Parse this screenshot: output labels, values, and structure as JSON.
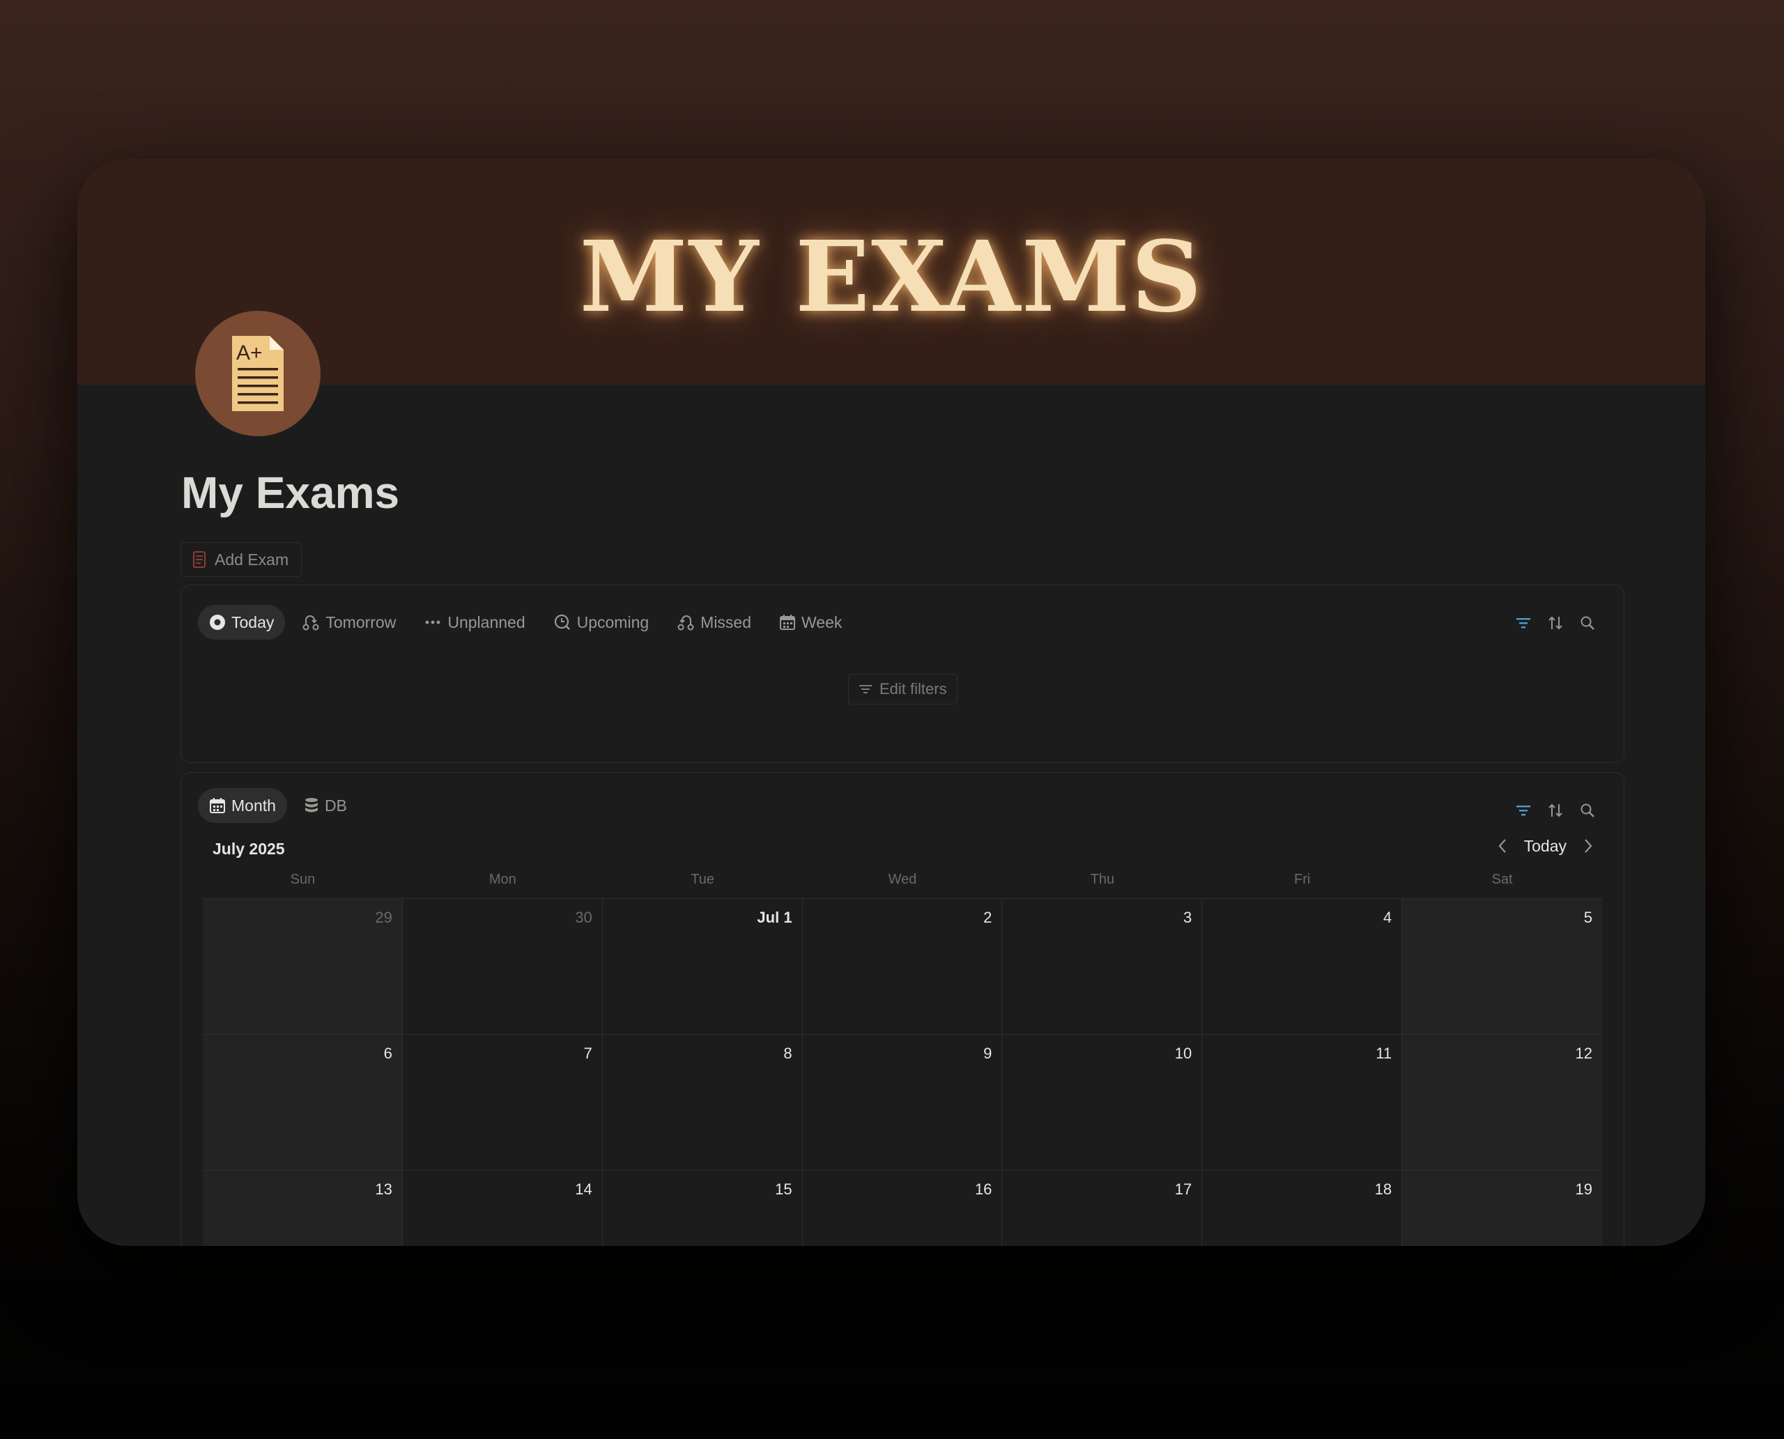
{
  "banner": {
    "title": "MY EXAMS"
  },
  "page": {
    "title": "My Exams",
    "icon": "document-aplus-icon"
  },
  "add_button": {
    "label": "Add Exam",
    "icon": "document-icon"
  },
  "views": {
    "tabs": [
      {
        "label": "Today",
        "icon": "circle-dot-icon",
        "active": true
      },
      {
        "label": "Tomorrow",
        "icon": "route-icon",
        "active": false
      },
      {
        "label": "Unplanned",
        "icon": "dots-icon",
        "active": false
      },
      {
        "label": "Upcoming",
        "icon": "clock-search-icon",
        "active": false
      },
      {
        "label": "Missed",
        "icon": "undo-route-icon",
        "active": false
      },
      {
        "label": "Week",
        "icon": "calendar-icon",
        "active": false
      }
    ],
    "edit_filters_label": "Edit filters"
  },
  "calendar": {
    "tabs": [
      {
        "label": "Month",
        "icon": "calendar-icon",
        "active": true
      },
      {
        "label": "DB",
        "icon": "database-icon",
        "active": false
      }
    ],
    "month_label": "July 2025",
    "today_label": "Today",
    "weekdays": [
      "Sun",
      "Mon",
      "Tue",
      "Wed",
      "Thu",
      "Fri",
      "Sat"
    ],
    "days": [
      "29",
      "30",
      "Jul 1",
      "2",
      "3",
      "4",
      "5",
      "6",
      "7",
      "8",
      "9",
      "10",
      "11",
      "12",
      "13",
      "14",
      "15",
      "16",
      "17",
      "18",
      "19"
    ]
  },
  "colors": {
    "accent": "#529cca",
    "banner": "#341f18",
    "background": "#1c1c1c",
    "glow": "#f6dfb7"
  }
}
